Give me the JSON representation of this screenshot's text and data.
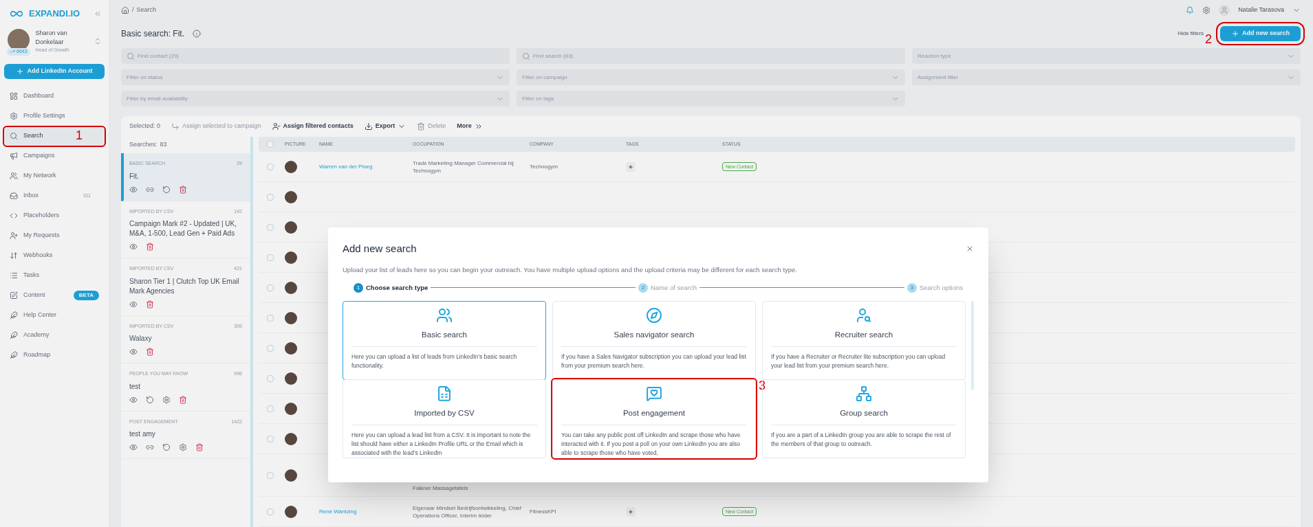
{
  "sidebar": {
    "logo": "EXPANDI.IO",
    "user": {
      "name": "Sharon van Donkelaar",
      "role": "Head of Growth",
      "badge": "6643"
    },
    "add_button": "Add LinkedIn Account",
    "items": [
      {
        "label": "Dashboard",
        "selected": false
      },
      {
        "label": "Profile Settings",
        "selected": false
      },
      {
        "label": "Search",
        "selected": true,
        "annotation": "1"
      },
      {
        "label": "Campaigns",
        "selected": false
      },
      {
        "label": "My Network",
        "selected": false
      },
      {
        "label": "Inbox",
        "selected": false,
        "badge": "311"
      },
      {
        "label": "Placeholders",
        "selected": false
      },
      {
        "label": "My Requests",
        "selected": false
      },
      {
        "label": "Webhooks",
        "selected": false
      },
      {
        "label": "Tasks",
        "selected": false
      },
      {
        "label": "Content",
        "selected": false,
        "tag": "BETA"
      },
      {
        "label": "Help Center",
        "selected": false
      },
      {
        "label": "Academy",
        "selected": false
      },
      {
        "label": "Roadmap",
        "selected": false
      }
    ]
  },
  "topbar": {
    "separator": "/",
    "breadcrumb": "Search",
    "user_name": "Natalie Tarasova"
  },
  "header": {
    "title": "Basic search: Fit.",
    "hide_filters": "Hide filters",
    "add_button": {
      "label": "Add new search",
      "annotation": "2"
    }
  },
  "filters": [
    {
      "kind": "search",
      "placeholder": "Find contact (29)"
    },
    {
      "kind": "search",
      "placeholder": "Find search (83)"
    },
    {
      "kind": "select",
      "placeholder": "Reaction type"
    },
    {
      "kind": "select",
      "placeholder": "Filter on status"
    },
    {
      "kind": "select",
      "placeholder": "Filter on campaign"
    },
    {
      "kind": "select",
      "placeholder": "Assignment filter"
    },
    {
      "kind": "select",
      "placeholder": "Filter by email availability"
    },
    {
      "kind": "select",
      "placeholder": "Filter on tags"
    }
  ],
  "toolbar": {
    "selected": "Selected: 0",
    "actions": [
      {
        "label": "Assign selected to campaign",
        "disabled": true
      },
      {
        "label": "Assign filtered contacts",
        "disabled": false
      },
      {
        "label": "Export",
        "disabled": false
      },
      {
        "label": "Delete",
        "disabled": true
      },
      {
        "label": "More",
        "disabled": false
      }
    ]
  },
  "searches": {
    "label": "Searches:",
    "count": "83",
    "items": [
      {
        "type": "BASIC SEARCH",
        "count": "29",
        "name": "Fit.",
        "selected": true,
        "actions": [
          {
            "kind": "view"
          },
          {
            "kind": "link"
          },
          {
            "kind": "refresh"
          },
          {
            "kind": "delete"
          }
        ]
      },
      {
        "type": "IMPORTED BY CSV",
        "count": "142",
        "name": "Campaign Mark #2 - Updated | UK, M&A, 1-500, Lead Gen + Paid Ads",
        "selected": false,
        "actions": [
          {
            "kind": "view"
          },
          {
            "kind": "delete"
          }
        ]
      },
      {
        "type": "IMPORTED BY CSV",
        "count": "421",
        "name": "Sharon Tier 1 | Clutch Top UK Email Mark Agencies",
        "selected": false,
        "actions": [
          {
            "kind": "view"
          },
          {
            "kind": "delete"
          }
        ]
      },
      {
        "type": "IMPORTED BY CSV",
        "count": "309",
        "name": "Walaxy",
        "selected": false,
        "actions": [
          {
            "kind": "view"
          },
          {
            "kind": "delete"
          }
        ]
      },
      {
        "type": "PEOPLE YOU MAY KNOW",
        "count": "996",
        "name": "test",
        "selected": false,
        "actions": [
          {
            "kind": "view"
          },
          {
            "kind": "refresh"
          },
          {
            "kind": "settings"
          },
          {
            "kind": "delete"
          }
        ]
      },
      {
        "type": "POST ENGAGEMENT",
        "count": "1422",
        "name": "test amy",
        "selected": false,
        "actions": [
          {
            "kind": "view"
          },
          {
            "kind": "link"
          },
          {
            "kind": "refresh"
          },
          {
            "kind": "settings"
          },
          {
            "kind": "delete"
          }
        ]
      }
    ]
  },
  "table": {
    "all_checked": false,
    "columns": [
      "PICTURE",
      "NAME",
      "OCCUPATION",
      "COMPANY",
      "TAGS",
      "STATUS"
    ],
    "rows": [
      {
        "checked": false,
        "name": "Warren van der Ploeg",
        "occupation": "Trade Marketing Manager Commercial bij Technogym",
        "company": "Technogym",
        "status": "New Contact"
      },
      {
        "checked": false
      },
      {
        "checked": false
      },
      {
        "checked": false
      },
      {
        "checked": false
      },
      {
        "checked": false
      },
      {
        "checked": false
      },
      {
        "checked": false
      },
      {
        "checked": false
      },
      {
        "checked": false
      },
      {
        "checked": false,
        "occupation": "Falkner Massagetafels"
      },
      {
        "checked": false,
        "name": "René Wantzing",
        "occupation": "Eigenaar Mindset Bedrijfsontwikkeling, Chief Operations Officer, Interim leider",
        "company": "FitnessKPI",
        "status": "New Contact"
      }
    ]
  },
  "modal": {
    "title": "Add new search",
    "intro": "Upload your list of leads here so you can begin your outreach. You have multiple upload options and the upload criteria may be different for each search type.",
    "steps": [
      {
        "number": "1",
        "label": "Choose search type",
        "selected": true
      },
      {
        "number": "2",
        "label": "Name of search",
        "selected": false
      },
      {
        "number": "3",
        "label": "Search options",
        "selected": false
      }
    ],
    "cards": [
      {
        "kind": "basic",
        "title": "Basic search",
        "text": "Here you can upload a list of leads from LinkedIn’s basic search functionality.",
        "selected": true
      },
      {
        "kind": "navigator",
        "title": "Sales navigator search",
        "text": "If you have a Sales Navigator subscription you can upload your lead list from your premium search here.",
        "selected": false
      },
      {
        "kind": "recruiter",
        "title": "Recruiter search",
        "text": "If you have a Recruiter or Recruiter lite subscription you can upload your lead list from your premium search here.",
        "selected": false
      },
      {
        "kind": "csv",
        "title": "Imported by CSV",
        "text": "Here you can upload a lead list from a CSV. It is important to note the list should have either a LinkedIn Profile URL or the Email which is associated with the lead’s LinkedIn",
        "selected": false
      },
      {
        "kind": "engagement",
        "title": "Post engagement",
        "text": "You can take any public post off LinkedIn and scrape those who have interacted with it. If you post a poll on your own LinkedIn you are also able to scrape those who have voted,",
        "selected": false,
        "annotation": "3"
      },
      {
        "kind": "group",
        "title": "Group search",
        "text": "If you are a part of a LinkedIn group you are able to scrape the rest of the members of that group to outreach.",
        "selected": false
      }
    ]
  }
}
